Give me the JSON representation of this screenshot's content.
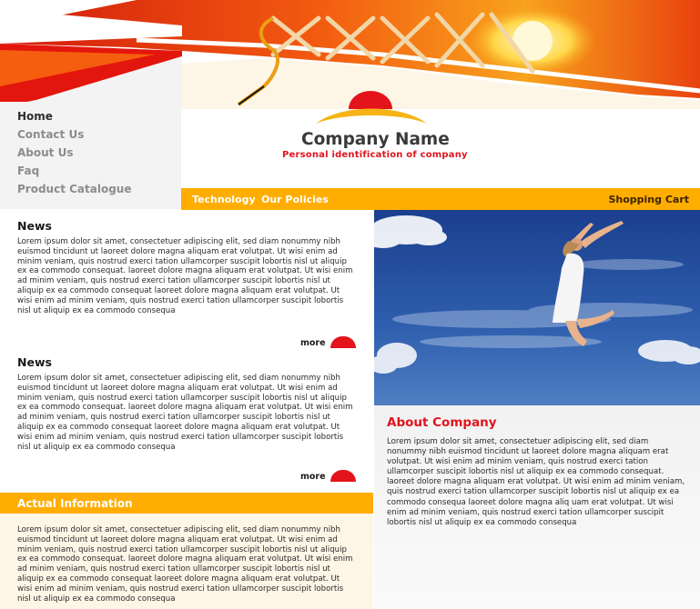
{
  "left_nav": {
    "items": [
      {
        "label": "Home"
      },
      {
        "label": "Contact Us"
      },
      {
        "label": "About Us"
      },
      {
        "label": "Faq"
      },
      {
        "label": "Product Catalogue"
      }
    ]
  },
  "brand": {
    "company_name": "Company Name",
    "tagline": "Personal identification of company"
  },
  "top_nav": {
    "technology": "Technology",
    "policies": "Our Policies",
    "cart": "Shopping Cart"
  },
  "news": [
    {
      "title": "News",
      "body": "Lorem ipsum dolor sit amet, consectetuer adipiscing elit, sed diam nonummy nibh euismod tincidunt ut laoreet dolore magna aliquam erat volutpat. Ut wisi enim ad minim veniam, quis nostrud exerci tation ullamcorper suscipit lobortis nisl ut aliquip ex ea commodo consequat. laoreet dolore magna aliquam erat volutpat. Ut wisi enim ad minim veniam, quis nostrud exerci tation ullamcorper suscipit lobortis nisl ut aliquip ex ea commodo consequat laoreet dolore magna aliquam erat volutpat. Ut wisi enim ad minim veniam, quis nostrud exerci tation ullamcorper suscipit lobortis nisl ut aliquip ex ea commodo consequa",
      "more": "more"
    },
    {
      "title": "News",
      "body": "Lorem ipsum dolor sit amet, consectetuer adipiscing elit, sed diam nonummy nibh euismod tincidunt ut laoreet dolore magna aliquam erat volutpat. Ut wisi enim ad minim veniam, quis nostrud exerci tation ullamcorper suscipit lobortis nisl ut aliquip ex ea commodo consequat. laoreet dolore magna aliquam erat volutpat. Ut wisi enim ad minim veniam, quis nostrud exerci tation ullamcorper suscipit lobortis nisl ut aliquip ex ea commodo consequat laoreet dolore magna aliquam erat volutpat. Ut wisi enim ad minim veniam, quis nostrud exerci tation ullamcorper suscipit lobortis nisl ut aliquip ex ea commodo consequa",
      "more": "more"
    }
  ],
  "actual_information": {
    "title": "Actual Information",
    "body": "Lorem ipsum dolor sit amet, consectetuer adipiscing elit, sed diam nonummy nibh euismod tincidunt ut laoreet dolore magna aliquam erat volutpat. Ut wisi enim ad minim veniam, quis nostrud exerci tation ullamcorper suscipit lobortis nisl ut aliquip ex ea commodo consequat. laoreet dolore magna aliquam erat volutpat. Ut wisi enim ad minim veniam, quis nostrud exerci tation ullamcorper suscipit lobortis nisl ut aliquip ex ea commodo consequat laoreet dolore magna aliquam erat volutpat. Ut wisi enim ad minim veniam, quis nostrud exerci tation ullamcorper suscipit lobortis nisl ut aliquip ex ea commodo consequa"
  },
  "about": {
    "title": "About Company",
    "body": "Lorem ipsum dolor sit amet, consectetuer adipiscing elit, sed diam nonummy nibh euismod tincidunt ut laoreet dolore magna aliquam erat volutpat. Ut wisi enim ad minim veniam, quis nostrud exerci tation ullamcorper suscipit lobortis nisl ut aliquip ex ea commodo consequat. laoreet dolore magna aliquam erat volutpat. Ut wisi enim ad minim veniam, quis nostrud exerci tation ullamcorper suscipit lobortis nisl ut aliquip ex ea commodo consequa laoreet dolore magna aliq uam erat volutpat. Ut wisi enim ad minim veniam, quis nostrud exerci tation ullamcorper suscipit lobortis nisl ut aliquip ex ea commodo consequa"
  },
  "icons": {
    "logo": "sunrise-logo-icon",
    "more": "red-dome-icon",
    "header": "laced-sunset-banner",
    "photo": "jumping-woman-sky-photo"
  },
  "colors": {
    "accent_orange": "#ffad00",
    "brand_red": "#e0141d",
    "cream": "#fdf6e7",
    "nav_gray": "#f3f3f3"
  }
}
